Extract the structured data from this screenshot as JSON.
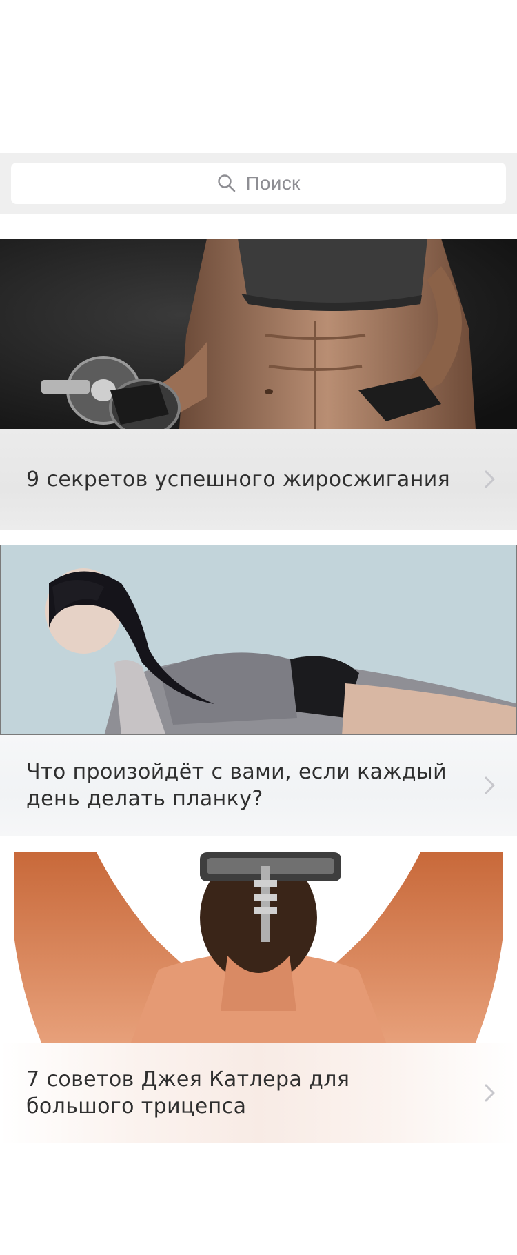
{
  "search": {
    "placeholder": "Поиск",
    "icon": "search-icon"
  },
  "articles": [
    {
      "title": "9 секретов успешного жиросжигания",
      "image": "fitness-woman-dumbbell-photo",
      "chevron": "chevron-right-icon"
    },
    {
      "title": "Что произойдёт с вами, если каждый день делать планку?",
      "image": "woman-plank-photo",
      "chevron": "chevron-right-icon"
    },
    {
      "title": "7 советов Джея Катлера для большого трицепса",
      "image": "man-triceps-dumbbell-photo",
      "chevron": "chevron-right-icon"
    }
  ],
  "colors": {
    "search_band": "#efefef",
    "text": "#2f2f2f",
    "placeholder": "#8e8e93",
    "chevron": "#c7c7cc"
  }
}
